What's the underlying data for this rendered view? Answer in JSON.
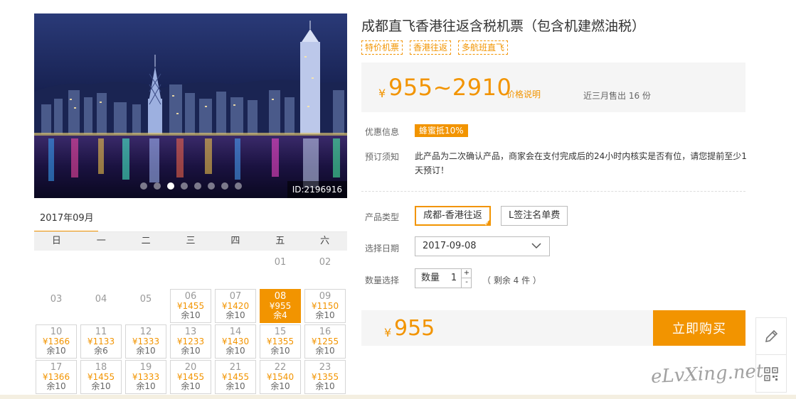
{
  "product": {
    "title": "成都直飞香港往返含税机票（包含机建燃油税）",
    "tags": [
      "特价机票",
      "香港往返",
      "多航班直飞"
    ],
    "image_id": "ID:2196916",
    "gallery_slides": 8,
    "gallery_active": 2
  },
  "price": {
    "currency": "¥",
    "range": "955~2910",
    "note_link": "价格说明",
    "sold": "近三月售出 16 份"
  },
  "promo": {
    "label": "优惠信息",
    "badge": "蜂蜜抵10%"
  },
  "notice": {
    "label": "预订须知",
    "text": "此产品为二次确认产品，商家会在支付完成后的24小时内核实是否有位，请您提前至少1天预订！"
  },
  "options": {
    "type_label": "产品类型",
    "types": [
      "成都-香港往返",
      "L签注名单费"
    ],
    "selected_type": 0,
    "date_label": "选择日期",
    "date_value": "2017-09-08",
    "qty_label": "数量选择",
    "qty_prefix": "数量",
    "qty_value": "1",
    "qty_plus": "+",
    "qty_minus": "-",
    "stock_text": "（ 剩余 4 件 ）"
  },
  "total": {
    "currency": "¥",
    "amount": "955",
    "buy_label": "立即购买"
  },
  "calendar": {
    "month": "2017年09月",
    "weekdays": [
      "日",
      "一",
      "二",
      "三",
      "四",
      "五",
      "六"
    ],
    "days": [
      {
        "day": "01",
        "col": 5,
        "row": 0
      },
      {
        "day": "02",
        "col": 6,
        "row": 0
      },
      {
        "day": "03",
        "col": 0,
        "row": 1
      },
      {
        "day": "04",
        "col": 1,
        "row": 1
      },
      {
        "day": "05",
        "col": 2,
        "row": 1
      },
      {
        "day": "06",
        "col": 3,
        "row": 1,
        "price": "¥1455",
        "remain": "余10"
      },
      {
        "day": "07",
        "col": 4,
        "row": 1,
        "price": "¥1420",
        "remain": "余10"
      },
      {
        "day": "08",
        "col": 5,
        "row": 1,
        "price": "¥955",
        "remain": "余4",
        "selected": true
      },
      {
        "day": "09",
        "col": 6,
        "row": 1,
        "price": "¥1150",
        "remain": "余10"
      },
      {
        "day": "10",
        "col": 0,
        "row": 2,
        "price": "¥1366",
        "remain": "余10"
      },
      {
        "day": "11",
        "col": 1,
        "row": 2,
        "price": "¥1133",
        "remain": "余6"
      },
      {
        "day": "12",
        "col": 2,
        "row": 2,
        "price": "¥1333",
        "remain": "余10"
      },
      {
        "day": "13",
        "col": 3,
        "row": 2,
        "price": "¥1233",
        "remain": "余10"
      },
      {
        "day": "14",
        "col": 4,
        "row": 2,
        "price": "¥1430",
        "remain": "余10"
      },
      {
        "day": "15",
        "col": 5,
        "row": 2,
        "price": "¥1355",
        "remain": "余10"
      },
      {
        "day": "16",
        "col": 6,
        "row": 2,
        "price": "¥1255",
        "remain": "余10"
      },
      {
        "day": "17",
        "col": 0,
        "row": 3,
        "price": "¥1366",
        "remain": "余10"
      },
      {
        "day": "18",
        "col": 1,
        "row": 3,
        "price": "¥1455",
        "remain": "余10"
      },
      {
        "day": "19",
        "col": 2,
        "row": 3,
        "price": "¥1333",
        "remain": "余10"
      },
      {
        "day": "20",
        "col": 3,
        "row": 3,
        "price": "¥1455",
        "remain": "余10"
      },
      {
        "day": "21",
        "col": 4,
        "row": 3,
        "price": "¥1455",
        "remain": "余10"
      },
      {
        "day": "22",
        "col": 5,
        "row": 3,
        "price": "¥1540",
        "remain": "余10"
      },
      {
        "day": "23",
        "col": 6,
        "row": 3,
        "price": "¥1355",
        "remain": "余10"
      }
    ]
  },
  "tools": {
    "edit_icon": "pencil-icon",
    "qr_icon": "qrcode-icon"
  },
  "watermark": "eLvXing.net",
  "colors": {
    "accent": "#f29400",
    "panel_bg": "#f5f5f5"
  }
}
